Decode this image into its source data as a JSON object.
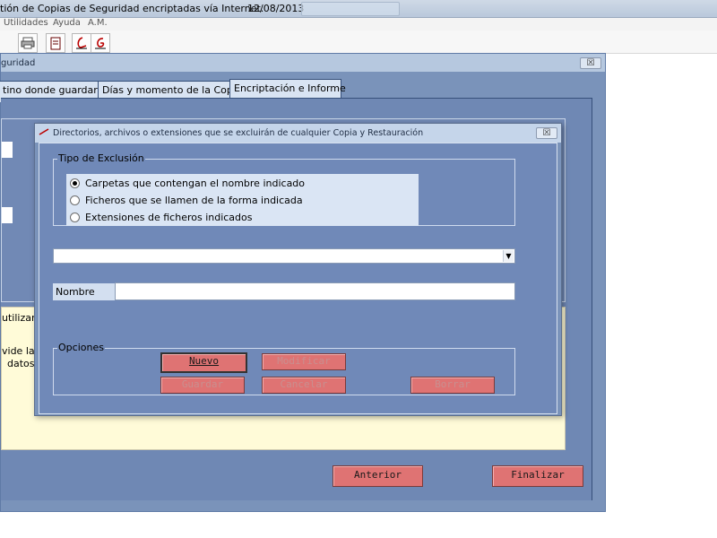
{
  "titlebar": {
    "title": "tión de Copias de Seguridad encriptadas vía Internet.",
    "date": "12/08/2013"
  },
  "menu": [
    "Utilidades",
    "Ayuda",
    "A.M."
  ],
  "toolbar_icons": [
    "printer-icon",
    "document-icon",
    "signature-icon",
    "signature-g-icon"
  ],
  "main_window": {
    "title": "guridad",
    "close_glyph": "☒",
    "tabs": [
      {
        "label": "tino donde guardarlos"
      },
      {
        "label": "Días y momento de la Copia"
      },
      {
        "label": "Encriptación e Informe",
        "active": true
      }
    ],
    "cut_texts": [
      "utilizará",
      "vide la C",
      "datos c"
    ],
    "buttons": {
      "anterior": "Anterior",
      "finalizar": "Finalizar"
    }
  },
  "dialog": {
    "title": "Directorios, archivos o extensiones que se excluirán de cualquier Copia y Restauración",
    "close_glyph": "☒",
    "exclusion_group": {
      "legend": "Tipo de Exclusión",
      "options": [
        {
          "label": "Carpetas que contengan el nombre indicado",
          "selected": true
        },
        {
          "label": "Ficheros que se llamen de la forma indicada",
          "selected": false
        },
        {
          "label": "Extensiones de ficheros indicados",
          "selected": false
        }
      ]
    },
    "combo": {
      "value": "",
      "arrow": "▼"
    },
    "nombre": {
      "label": "Nombre",
      "value": ""
    },
    "options_group": {
      "legend": "Opciones",
      "buttons": {
        "nuevo": "Nuevo",
        "modificar": "Modificar",
        "guardar": "Guardar",
        "cancelar": "Cancelar",
        "borrar": "Borrar"
      }
    }
  }
}
